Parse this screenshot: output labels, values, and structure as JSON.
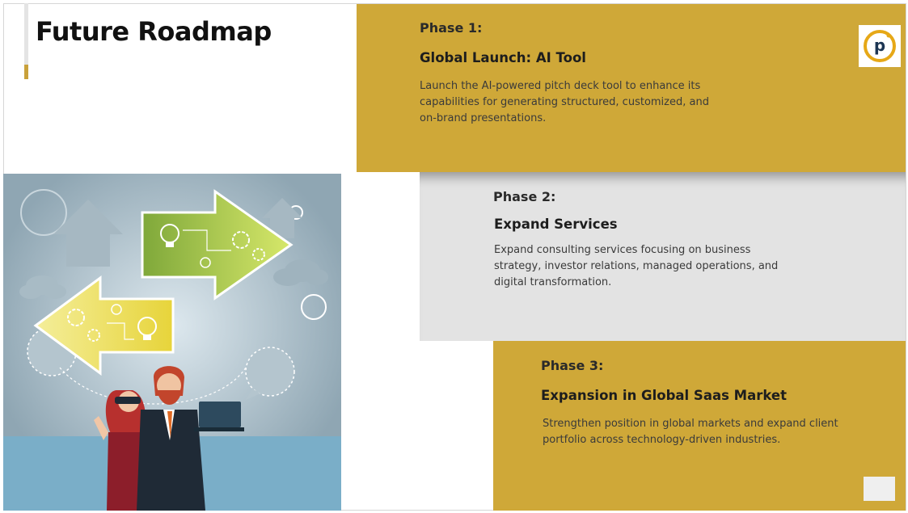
{
  "title": "Future Roadmap",
  "phases": [
    {
      "label": "Phase 1:",
      "heading": "Global Launch: AI Tool",
      "description_lines": [
        "Launch the AI-powered pitch deck tool to enhance its",
        "capabilities for generating structured, customized, and",
        "on-brand presentations."
      ]
    },
    {
      "label": "Phase 2:",
      "heading": "Expand Services",
      "description_lines": [
        "Expand consulting services focusing on business",
        "strategy, investor relations, managed operations, and",
        "digital transformation."
      ]
    },
    {
      "label": "Phase 3:",
      "heading": "Expansion in Global Saas Market",
      "description_lines": [
        "Strengthen position in global markets and expand client",
        "portfolio across technology-driven industries."
      ]
    }
  ],
  "logo": {
    "letter": "p"
  },
  "colors": {
    "gold": "#cfa838",
    "light_gray": "#e3e3e3",
    "illustration_bg": "#8fa6b3",
    "floor": "#7aaec8",
    "logo_navy": "#1c3553",
    "logo_gold": "#e6a817"
  },
  "icons": [
    "logo-p-icon",
    "arrow-right-icon",
    "arrow-left-icon",
    "lightbulb-icon",
    "gear-icon",
    "cloud-icon",
    "speech-bubble-icon",
    "vr-headset-icon",
    "laptop-icon"
  ]
}
